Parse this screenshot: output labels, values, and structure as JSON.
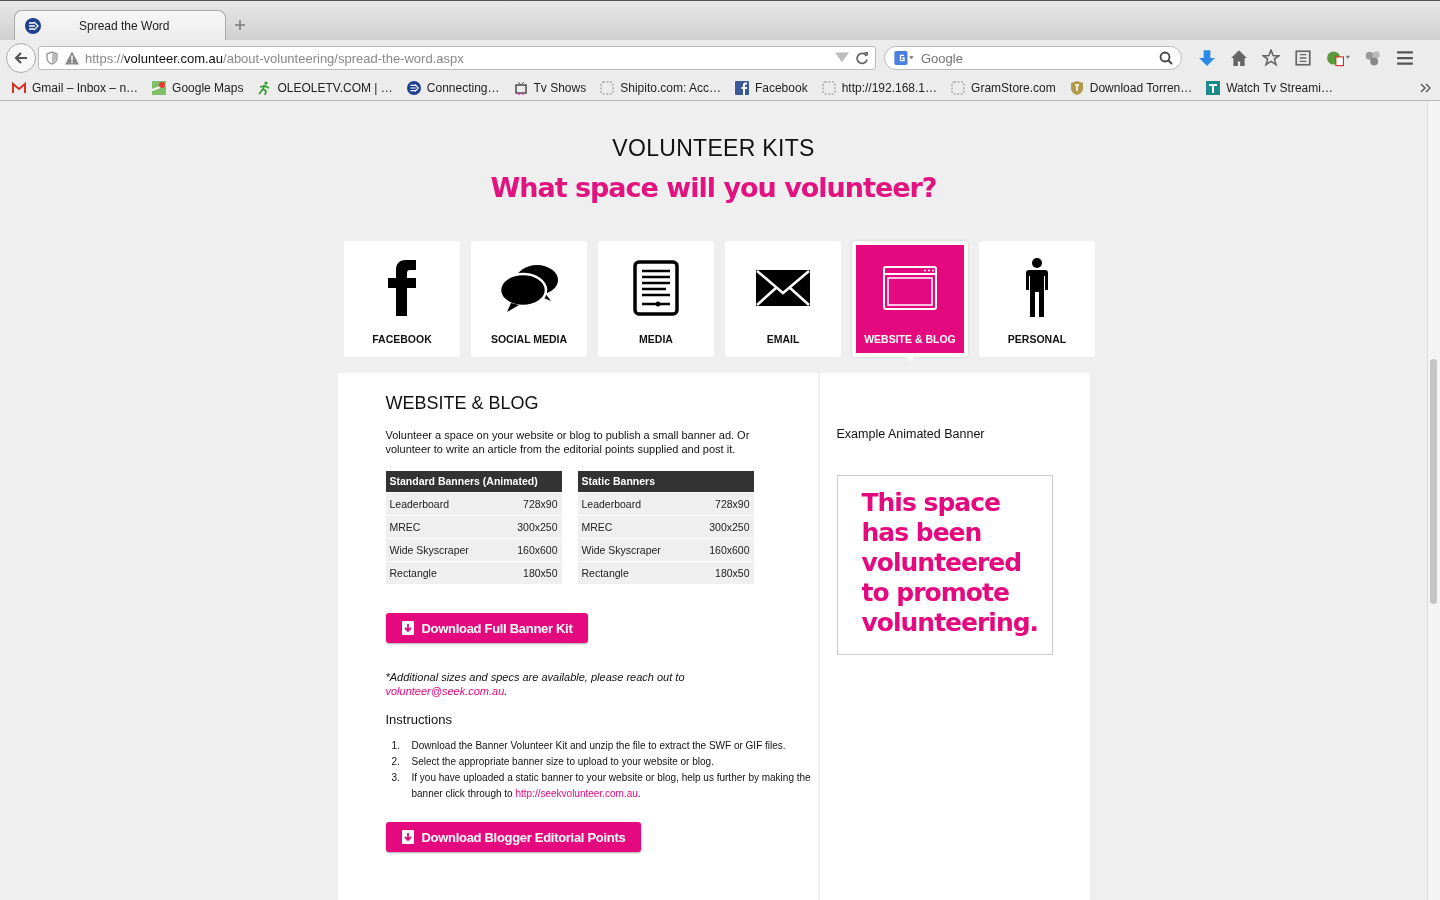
{
  "browser": {
    "tab": {
      "title": "Spread the Word",
      "selected": true
    },
    "url": {
      "scheme": "https://",
      "host": "volunteer.com.au",
      "path": "/about-volunteering/spread-the-word.aspx"
    },
    "search": {
      "placeholder": "Google"
    },
    "bookmarks": [
      {
        "label": "Gmail – Inbox – n…",
        "kind": "mail"
      },
      {
        "label": "Google Maps",
        "kind": "map"
      },
      {
        "label": "OLEOLETV.COM | …",
        "kind": "runner"
      },
      {
        "label": "Connecting…",
        "kind": "arrow"
      },
      {
        "label": "Tv Shows",
        "kind": "tv"
      },
      {
        "label": "Shipito.com: Acc…",
        "kind": "blank"
      },
      {
        "label": "Facebook",
        "kind": "f"
      },
      {
        "label": "http://192.168.1…",
        "kind": "blank"
      },
      {
        "label": "GramStore.com",
        "kind": "blank"
      },
      {
        "label": "Download Torren…",
        "kind": "shield"
      },
      {
        "label": "Watch Tv Streami…",
        "kind": "tsquare"
      }
    ]
  },
  "page": {
    "heading": "VOLUNTEER KITS",
    "subheading": "What space will you volunteer?",
    "categories": [
      {
        "label": "FACEBOOK",
        "kind": "f",
        "selected": false
      },
      {
        "label": "SOCIAL MEDIA",
        "kind": "bubbles",
        "selected": false
      },
      {
        "label": "MEDIA",
        "kind": "document",
        "selected": false
      },
      {
        "label": "EMAIL",
        "kind": "envelope",
        "selected": false
      },
      {
        "label": "WEBSITE & BLOG",
        "kind": "browser",
        "selected": true
      },
      {
        "label": "PERSONAL",
        "kind": "person",
        "selected": false
      }
    ],
    "section_title": "WEBSITE & BLOG",
    "intro": "Volunteer a space on your website or blog to publish a small banner ad. Or volunteer to write an article from the editorial points supplied and post it.",
    "tables": [
      {
        "title": "Standard Banners (Animated)",
        "rows": [
          {
            "name": "Leaderboard",
            "size": "728x90"
          },
          {
            "name": "MREC",
            "size": "300x250"
          },
          {
            "name": "Wide Skyscraper",
            "size": "160x600"
          },
          {
            "name": "Rectangle",
            "size": "180x50"
          }
        ]
      },
      {
        "title": "Static Banners",
        "rows": [
          {
            "name": "Leaderboard",
            "size": "728x90"
          },
          {
            "name": "MREC",
            "size": "300x250"
          },
          {
            "name": "Wide Skyscraper",
            "size": "160x600"
          },
          {
            "name": "Rectangle",
            "size": "180x50"
          }
        ]
      }
    ],
    "download_kit_button": "Download Full Banner Kit",
    "note": {
      "text": "*Additional sizes and specs are available, please reach out to ",
      "link": "volunteer@seek.com.au",
      "end": "."
    },
    "instructions_title": "Instructions",
    "steps": [
      {
        "number": "1.",
        "text": "Download the Banner Volunteer Kit and unzip the file to extract the SWF or GIF files."
      },
      {
        "number": "2.",
        "text": "Select the appropriate banner size to upload to your website or blog."
      },
      {
        "number": "3.",
        "text": "If you have uploaded a static banner to your website or blog, help us further by making the banner click through to ",
        "link": "http://seekvolunteer.com.au",
        "end": "."
      }
    ],
    "download_points_button": "Download Blogger Editorial Points",
    "example_label": "Example Animated Banner",
    "banner_lines": [
      "This space",
      "has been",
      "volunteered",
      "to promote",
      "volunteering."
    ]
  }
}
